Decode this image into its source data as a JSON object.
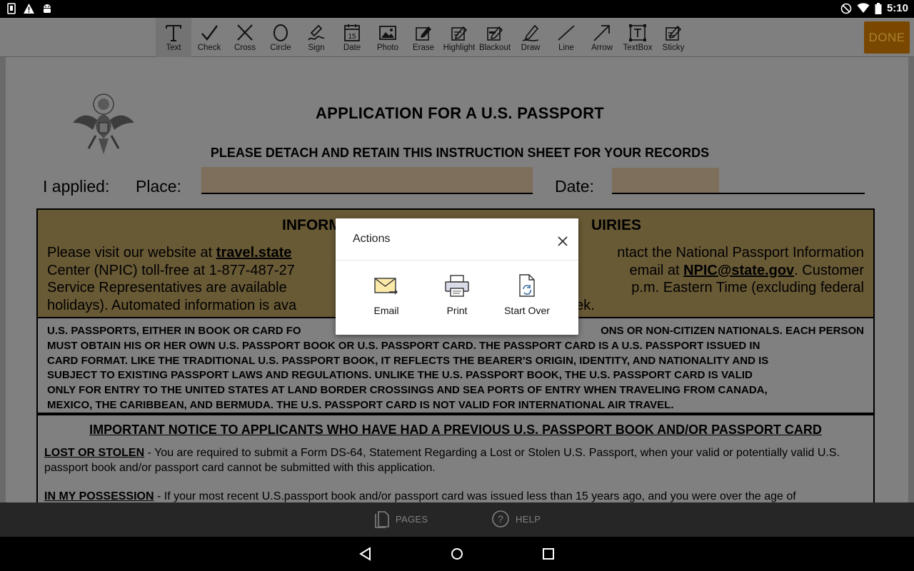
{
  "status_bar": {
    "time": "5:10",
    "icons": [
      "sim-card-icon",
      "warning-icon",
      "android-icon",
      "do-not-disturb-icon",
      "wifi-icon",
      "battery-icon"
    ]
  },
  "toolbar": {
    "tools": [
      {
        "id": "text",
        "label": "Text",
        "icon": "text-icon",
        "active": true
      },
      {
        "id": "check",
        "label": "Check",
        "icon": "check-icon"
      },
      {
        "id": "cross",
        "label": "Cross",
        "icon": "cross-icon"
      },
      {
        "id": "circle",
        "label": "Circle",
        "icon": "circle-icon"
      },
      {
        "id": "sign",
        "label": "Sign",
        "icon": "sign-icon"
      },
      {
        "id": "date",
        "label": "Date",
        "icon": "calendar-icon",
        "calendar_day": "15"
      },
      {
        "id": "photo",
        "label": "Photo",
        "icon": "photo-icon"
      },
      {
        "id": "erase",
        "label": "Erase",
        "icon": "erase-icon"
      },
      {
        "id": "highlight",
        "label": "Highlight",
        "icon": "highlight-icon"
      },
      {
        "id": "blackout",
        "label": "Blackout",
        "icon": "blackout-icon"
      },
      {
        "id": "draw",
        "label": "Draw",
        "icon": "draw-icon"
      },
      {
        "id": "line",
        "label": "Line",
        "icon": "line-icon"
      },
      {
        "id": "arrow",
        "label": "Arrow",
        "icon": "arrow-icon"
      },
      {
        "id": "textbox",
        "label": "TextBox",
        "icon": "textbox-icon"
      },
      {
        "id": "sticky",
        "label": "Sticky",
        "icon": "sticky-icon"
      }
    ],
    "done_label": "DONE"
  },
  "document": {
    "title": "APPLICATION FOR A U.S. PASSPORT",
    "subtitle": "PLEASE DETACH AND RETAIN THIS INSTRUCTION SHEET FOR YOUR RECORDS",
    "applied_label": "I applied:",
    "place_label": "Place:",
    "date_label": "Date:",
    "info_heading_left": "INFORM",
    "info_heading_right": "UIRIES",
    "info_lines": [
      {
        "left": "Please visit our website at ",
        "bold": "travel.state",
        "right": "ntact the National Passport Information"
      },
      {
        "left": "Center (NPIC) toll-free at 1-877-487-27",
        "right_pre": "email at ",
        "bold2": "NPIC@state.gov",
        "right": ".  Customer"
      },
      {
        "left": "Service Representatives are available",
        "right": "p.m. Eastern Time (excluding federal"
      },
      {
        "left": "holidays).  Automated information is ava",
        "right": "ek."
      }
    ],
    "passport_card_lines": [
      "U.S. PASSPORTS, EITHER IN BOOK OR CARD FO",
      "ONS OR NON-CITIZEN NATIONALS.  EACH PERSON",
      "MUST OBTAIN HIS OR HER OWN U.S. PASSPORT BOOK OR U.S. PASSPORT CARD.  THE PASSPORT CARD IS A U.S. PASSPORT ISSUED IN",
      "CARD FORMAT.  LIKE THE TRADITIONAL U.S. PASSPORT BOOK, IT REFLECTS THE BEARER'S ORIGIN, IDENTITY, AND NATIONALITY AND IS",
      "SUBJECT TO EXISTING PASSPORT LAWS AND REGULATIONS.  UNLIKE THE U.S. PASSPORT BOOK, THE U.S. PASSPORT CARD IS VALID",
      "ONLY FOR ENTRY TO THE UNITED STATES AT LAND BORDER CROSSINGS AND SEA PORTS OF ENTRY WHEN TRAVELING FROM CANADA,",
      "MEXICO, THE CARIBBEAN, AND BERMUDA.  THE U.S. PASSPORT CARD IS NOT VALID FOR INTERNATIONAL AIR TRAVEL."
    ],
    "notice_heading": "IMPORTANT NOTICE TO APPLICANTS WHO HAVE HAD A PREVIOUS U.S. PASSPORT BOOK AND/OR PASSPORT CARD",
    "lost_heading": "LOST OR STOLEN",
    "lost_text": " - You are required to submit a Form DS-64, Statement Regarding a Lost or Stolen U.S. Passport, when your valid or potentially valid U.S. passport book and/or passport card cannot be submitted with this application.",
    "possession_heading": "IN MY POSSESSION",
    "possession_text": " - If your most recent U.S.passport book and/or passport card was issued less than 15 years ago, and you were over the age of"
  },
  "dialog": {
    "title": "Actions",
    "actions": [
      {
        "label": "Email",
        "icon": "email-icon"
      },
      {
        "label": "Print",
        "icon": "printer-icon"
      },
      {
        "label": "Start Over",
        "icon": "start-over-icon"
      }
    ]
  },
  "bottom_bar": {
    "pages_label": "PAGES",
    "help_label": "HELP"
  },
  "colors": {
    "accent": "#7a4700",
    "toolbar_bg": "#7f7f7f",
    "highlight_field": "#7d6f5b",
    "info_box_bg": "#695a36"
  }
}
